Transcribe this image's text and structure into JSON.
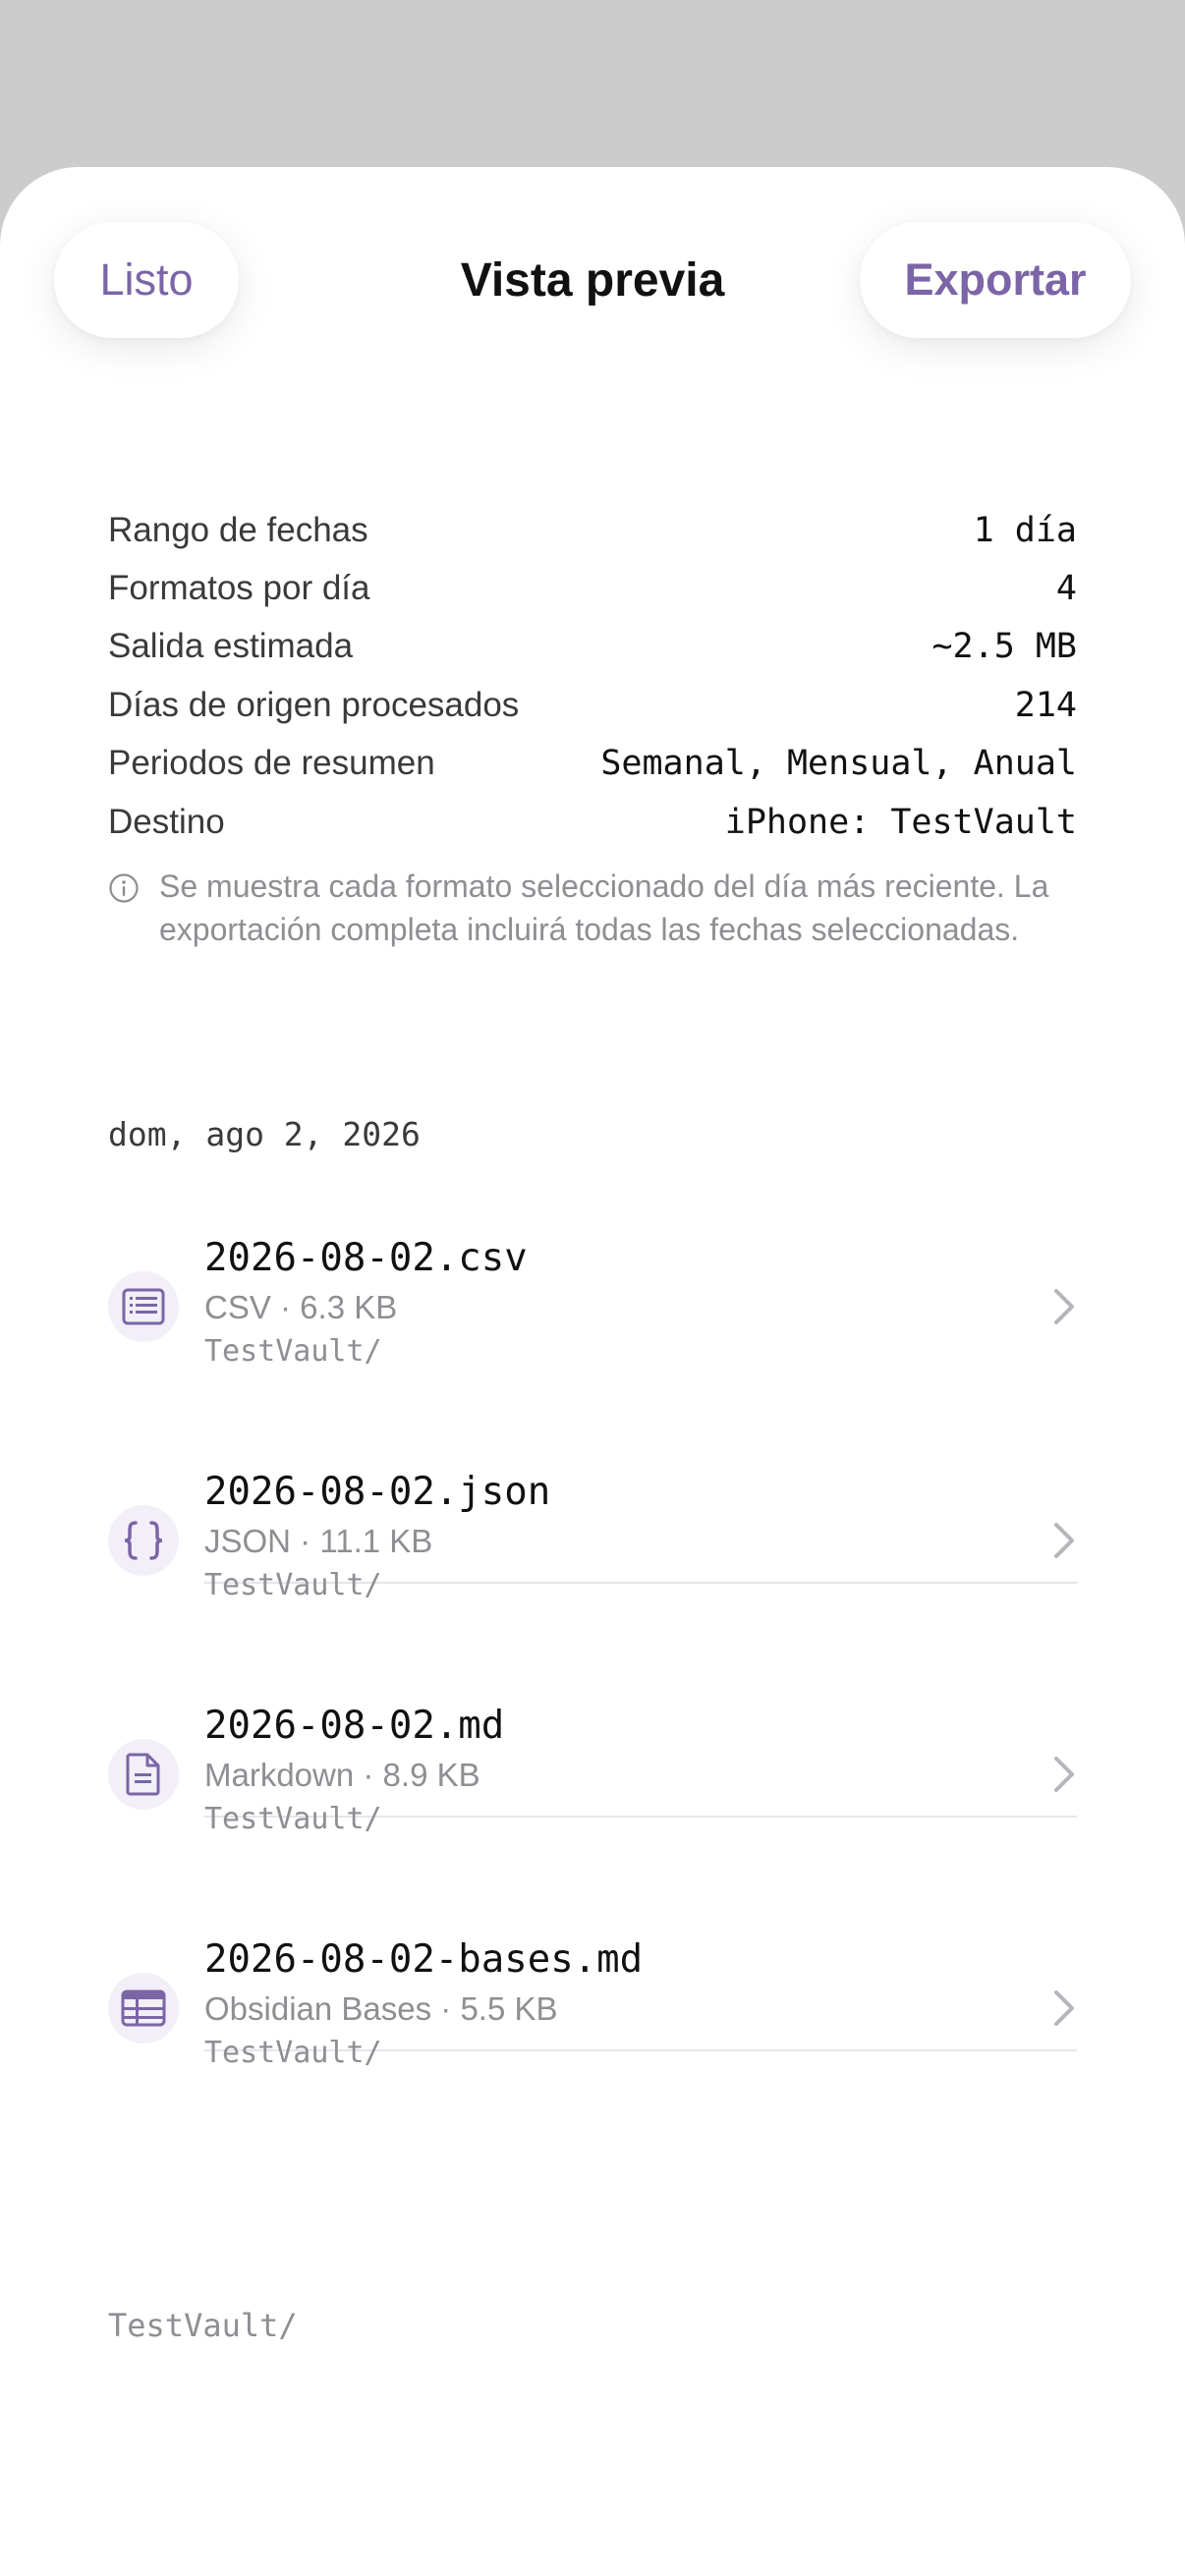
{
  "header": {
    "done_label": "Listo",
    "title": "Vista previa",
    "export_label": "Exportar"
  },
  "summary": {
    "rows": [
      {
        "key": "Rango de fechas",
        "value": "1 día"
      },
      {
        "key": "Formatos por día",
        "value": "4"
      },
      {
        "key": "Salida estimada",
        "value": "~2.5 MB"
      },
      {
        "key": "Días de origen procesados",
        "value": "214"
      },
      {
        "key": "Periodos de resumen",
        "value": "Semanal, Mensual, Anual"
      },
      {
        "key": "Destino",
        "value": "iPhone: TestVault"
      }
    ],
    "note": "Se muestra cada formato seleccionado del día más reciente. La exportación completa incluirá todas las fechas seleccionadas."
  },
  "date_header": "dom, ago 2, 2026",
  "files": [
    {
      "name": "2026-08-02.csv",
      "meta": "CSV · 6.3 KB",
      "path": "TestVault/",
      "icon": "list-document-icon"
    },
    {
      "name": "2026-08-02.json",
      "meta": "JSON · 11.1 KB",
      "path": "TestVault/",
      "icon": "curly-braces-icon"
    },
    {
      "name": "2026-08-02.md",
      "meta": "Markdown · 8.9 KB",
      "path": "TestVault/",
      "icon": "document-icon"
    },
    {
      "name": "2026-08-02-bases.md",
      "meta": "Obsidian Bases · 5.5 KB",
      "path": "TestVault/",
      "icon": "table-icon"
    }
  ],
  "footer_path": "TestVault/",
  "colors": {
    "accent": "#7b65a6",
    "backdrop": "#cccccc",
    "secondary_text": "#8e8e93"
  }
}
